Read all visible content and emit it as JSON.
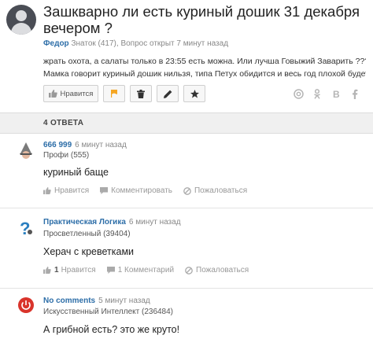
{
  "question": {
    "title": "Зашкварно ли есть куриный дошик 31 декабря вечером ?",
    "author": "Федор",
    "author_rank": "Знаток (417),",
    "status": "Вопрос открыт 7 минут назад",
    "body_line1": "жрать охота, а салаты только в 23:55 есть можна. Или лучша Говыжий Заварить ???",
    "body_line2": "Мамка говорит куриный дошик нильзя, типа Петух обидится и весь год плохой будет...",
    "like_label": "Нравится",
    "share_icons": [
      "mail-share-icon",
      "odnoklassniki-share-icon",
      "vk-share-icon",
      "facebook-share-icon"
    ]
  },
  "answers_header": "4 ОТВЕТА",
  "answers": [
    {
      "name": "666 999",
      "time": "6 минут назад",
      "rank": "Профи (555)",
      "text": "куриный баще",
      "like": "Нравится",
      "like_count": "",
      "comment": "Комментировать",
      "report": "Пожаловаться"
    },
    {
      "name": "Практическая Логика",
      "time": "6 минут назад",
      "rank": "Просветленный (39404)",
      "text": "Херач с креветками",
      "like": "Нравится",
      "like_count": "1",
      "comment": "1 Комментарий",
      "report": "Пожаловаться"
    },
    {
      "name": "No comments",
      "time": "5 минут назад",
      "rank": "Искусственный Интеллект (236484)",
      "text": "А грибной есть? это же круто!"
    }
  ],
  "colors": {
    "link": "#2d6ea8",
    "header_bg": "#f0f0f0",
    "flag": "#f5a623",
    "avatar3": "#d9342b"
  }
}
